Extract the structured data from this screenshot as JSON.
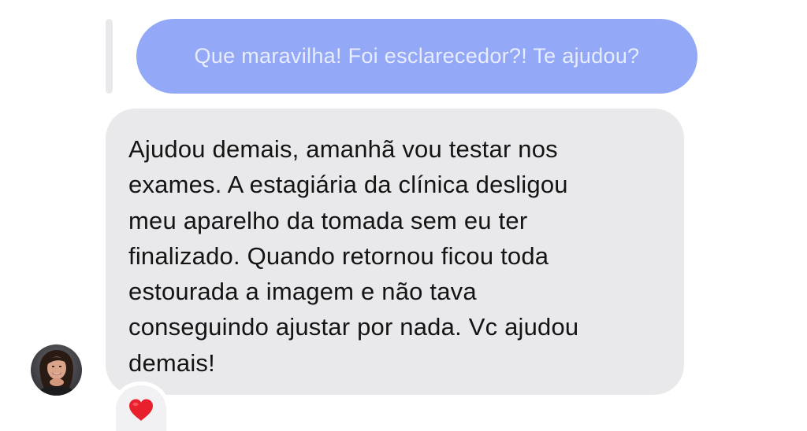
{
  "conversation": {
    "quoted_message": {
      "text": "Que maravilha! Foi esclarecedor?! Te ajudou?",
      "bubble_color": "#93a8f6"
    },
    "received_message": {
      "lines": [
        "Ajudou demais, amanhã vou testar nos",
        "exames. A estagiária da clínica desligou",
        "meu aparelho da tomada sem eu ter",
        "finalizado. Quando retornou ficou toda",
        "estourada a imagem e não tava",
        "conseguindo ajustar por nada. Vc ajudou",
        "demais!"
      ],
      "bubble_color": "#e9e9eb"
    },
    "sender_avatar": {
      "icon": "person-avatar-icon"
    },
    "reaction": {
      "icon": "red-heart-icon",
      "color": "#e8202e"
    }
  }
}
